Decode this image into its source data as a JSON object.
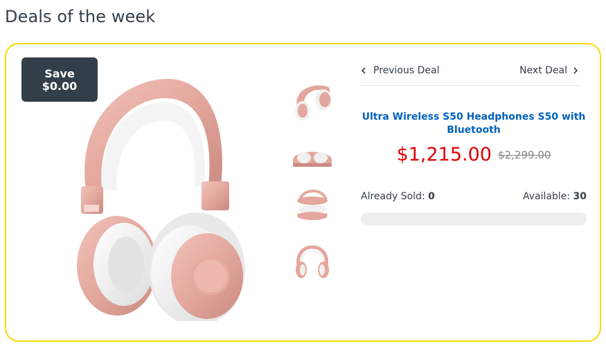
{
  "section": {
    "title": "Deals of the week"
  },
  "deal": {
    "save_label": "Save",
    "save_amount": "$0.00",
    "nav": {
      "previous": "Previous Deal",
      "next": "Next Deal"
    },
    "product_title": "Ultra Wireless S50 Headphones S50 with Bluetooth",
    "price_current": "$1,215.00",
    "price_old": "$2,299.00",
    "already_sold_label": "Already Sold:",
    "already_sold_value": "0",
    "available_label": "Available:",
    "available_value": "30",
    "progress_fraction": 0,
    "thumbnails": [
      "headphones-side",
      "headphones-folded",
      "headphones-top",
      "headphones-front"
    ]
  },
  "colors": {
    "accent": "#fed700",
    "badge": "#333e48",
    "price": "#df0000",
    "link": "#0062bd",
    "product": "#e8a9a0"
  }
}
